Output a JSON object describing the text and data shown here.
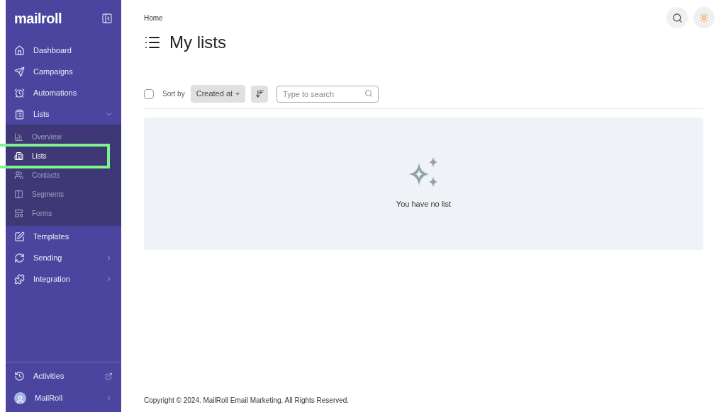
{
  "sidebar": {
    "logo": "mailroll",
    "items": [
      {
        "label": "Dashboard",
        "kind": "link"
      },
      {
        "label": "Campaigns",
        "kind": "link"
      },
      {
        "label": "Automations",
        "kind": "link"
      },
      {
        "label": "Lists",
        "kind": "group",
        "expanded": true,
        "children": [
          {
            "label": "Overview",
            "selected": false,
            "highlighted": false
          },
          {
            "label": "Lists",
            "selected": true,
            "highlighted": true
          },
          {
            "label": "Contacts",
            "selected": false,
            "highlighted": false
          },
          {
            "label": "Segments",
            "selected": false,
            "highlighted": false
          },
          {
            "label": "Forms",
            "selected": false,
            "highlighted": false
          }
        ]
      },
      {
        "label": "Templates",
        "kind": "link"
      },
      {
        "label": "Sending",
        "kind": "group",
        "expanded": false
      },
      {
        "label": "Integration",
        "kind": "group",
        "expanded": false
      }
    ],
    "footer": [
      {
        "label": "Activities",
        "kind": "external"
      },
      {
        "label": "MailRoll",
        "kind": "account"
      }
    ]
  },
  "breadcrumb": "Home",
  "title": "My lists",
  "toolbar": {
    "select_all": {
      "checked": false
    },
    "sort_label": "Sort by",
    "sort_value": "Created at",
    "search": {
      "placeholder": "Type to search"
    }
  },
  "empty_state": "You have no list",
  "footer": "Copyright © 2024. MailRoll Email Marketing. All Rights Reserved."
}
